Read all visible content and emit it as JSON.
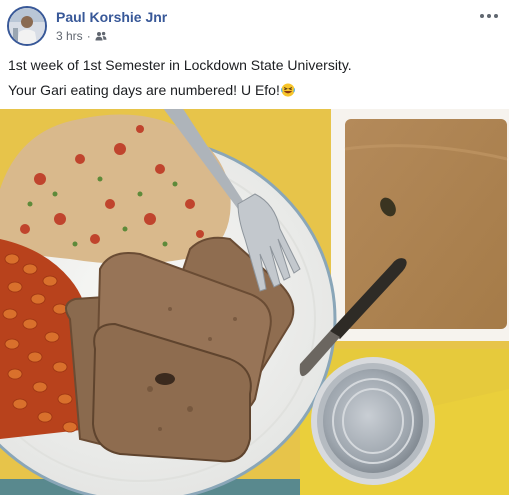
{
  "post": {
    "author": "Paul Korshie Jnr",
    "timestamp": "3 hrs",
    "separator": "·",
    "audience_icon": "friends-icon",
    "more_icon": "more-options-icon",
    "lines": [
      "1st week of 1st Semester in Lockdown State University.",
      "Your Gari eating days are numbered! U Efo!"
    ],
    "emoji": "rolling-on-floor-laughing-emoji"
  },
  "colors": {
    "author_link": "#385898",
    "meta_text": "#616770",
    "body_text": "#1c1e21",
    "tray_yellow": "#e8c84a",
    "plate": "#f4f4f2"
  }
}
